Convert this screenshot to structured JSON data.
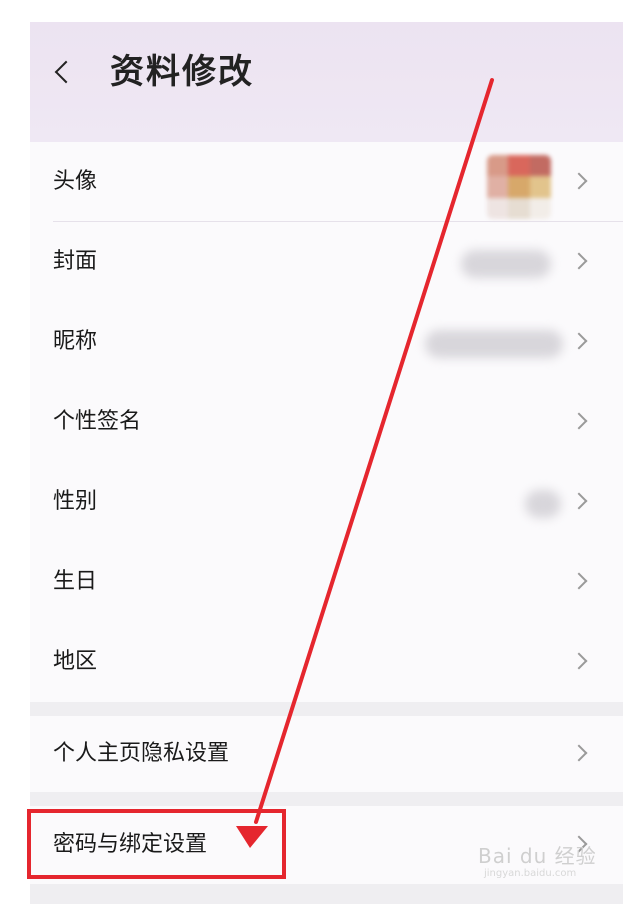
{
  "header": {
    "title": "资料修改"
  },
  "profile_rows": [
    {
      "label": "头像"
    },
    {
      "label": "封面"
    },
    {
      "label": "昵称"
    },
    {
      "label": "个性签名"
    },
    {
      "label": "性别"
    },
    {
      "label": "生日"
    },
    {
      "label": "地区"
    }
  ],
  "privacy_row": {
    "label": "个人主页隐私设置"
  },
  "password_row": {
    "label": "密码与绑定设置"
  },
  "watermark": {
    "brand": "Bai du 经验",
    "url": "jingyan.baidu.com"
  },
  "avatar_colors": [
    "#d89a88",
    "#d9675c",
    "#c26b62",
    "#e0b0a4",
    "#d7a86a",
    "#e2c48c",
    "#eee4e2",
    "#e6ddd2",
    "#f2ede8"
  ],
  "colors": {
    "highlight": "#e5262e",
    "arrow": "#e5262e",
    "chevron": "#9a9a9a"
  }
}
